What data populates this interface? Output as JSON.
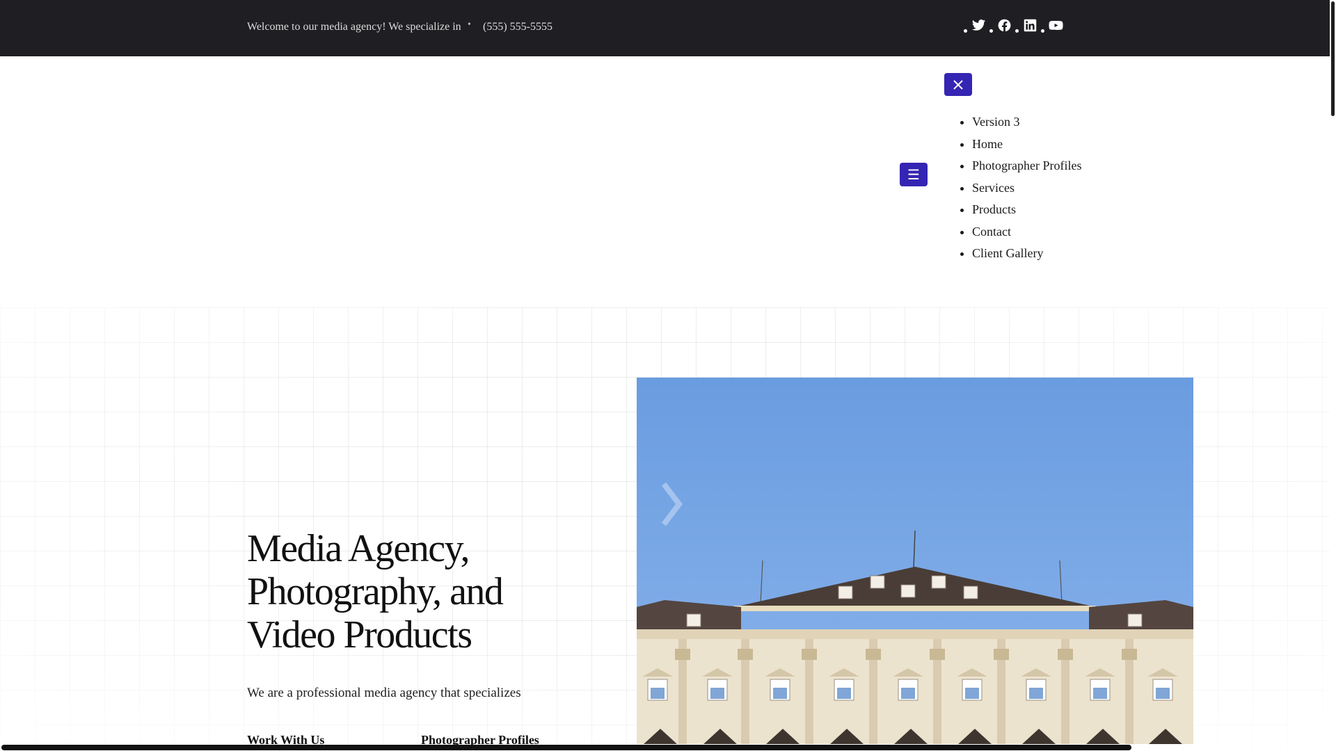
{
  "topbar": {
    "welcome_text": "Welcome to our media agency! We specialize in",
    "separator": "•",
    "phone": "(555) 555-5555",
    "social_icons": [
      "twitter-icon",
      "facebook-icon",
      "linkedin-icon",
      "youtube-icon"
    ]
  },
  "header": {
    "menu_toggle_glyph": "☰",
    "nav": {
      "items": [
        {
          "label": "Version 3"
        },
        {
          "label": "Home"
        },
        {
          "label": "Photographer Profiles"
        },
        {
          "label": "Services"
        },
        {
          "label": "Products"
        },
        {
          "label": "Contact"
        },
        {
          "label": "Client Gallery"
        }
      ]
    }
  },
  "hero": {
    "title_line1": "Media Agency,",
    "title_line2": "Photography, and",
    "title_line3": "Video Products",
    "subtitle": "We are a professional media agency that specializes",
    "links": {
      "work_with_us": "Work With Us",
      "photographer_profiles": "Photographer Profiles"
    },
    "image_icon": "building-photo"
  },
  "colors": {
    "accent": "#3525b3",
    "topbar_bg": "#1f1f23",
    "sky": "#6d9fe0"
  }
}
